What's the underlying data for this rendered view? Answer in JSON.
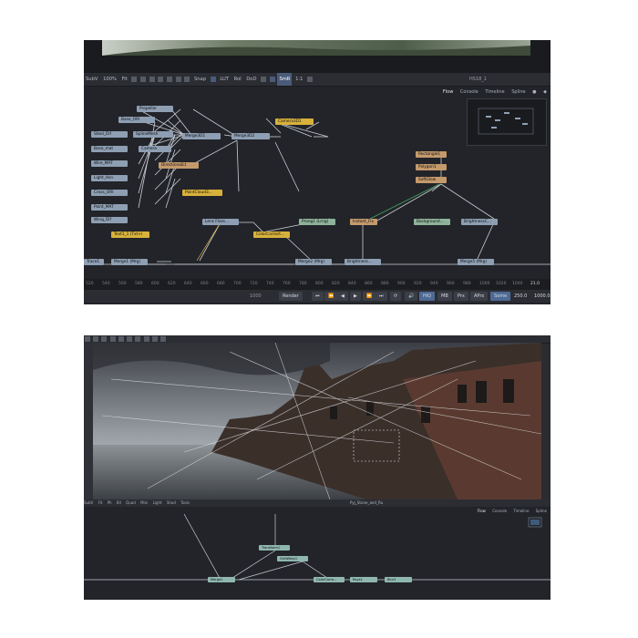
{
  "top": {
    "window_title": "HS18_1",
    "toolbar": {
      "items": [
        "SubV",
        "100%",
        "Fit",
        "Snap",
        "LUT",
        "RoI",
        "DoD",
        "SmR",
        "1:1"
      ]
    },
    "tabs": [
      "Flow",
      "Console",
      "Timeline",
      "Spline"
    ],
    "nodes": [
      {
        "id": "n1",
        "label": "Propeller",
        "color": "blue"
      },
      {
        "id": "n2",
        "label": "Base_ORI",
        "color": "blue"
      },
      {
        "id": "n3",
        "label": "Steel_Dif",
        "color": "blue"
      },
      {
        "id": "n4",
        "label": "SplineMesh",
        "color": "blue"
      },
      {
        "id": "n5",
        "label": "Merge3D1",
        "color": "blue"
      },
      {
        "id": "n6",
        "label": "Merge3D2",
        "color": "blue"
      },
      {
        "id": "n7",
        "label": "Camera3D1",
        "color": "yellow"
      },
      {
        "id": "n8",
        "label": "Base_mat",
        "color": "blue"
      },
      {
        "id": "n9",
        "label": "Camera",
        "color": "blue"
      },
      {
        "id": "n10",
        "label": "Wire_MAT",
        "color": "blue"
      },
      {
        "id": "n11",
        "label": "DirectionalLt",
        "color": "orange"
      },
      {
        "id": "n12",
        "label": "Light_Hsn",
        "color": "blue"
      },
      {
        "id": "n13",
        "label": "Cross_ORI",
        "color": "blue"
      },
      {
        "id": "n14",
        "label": "Point_MAT",
        "color": "blue"
      },
      {
        "id": "n15",
        "label": "Wing_Dif",
        "color": "blue"
      },
      {
        "id": "n16",
        "label": "PointCloud3...",
        "color": "yellow"
      },
      {
        "id": "n17",
        "label": "Rectangle1",
        "color": "orange"
      },
      {
        "id": "n18",
        "label": "Polygon1",
        "color": "orange"
      },
      {
        "id": "n19",
        "label": "SoftGlow",
        "color": "orange"
      },
      {
        "id": "n20",
        "label": "Text1_1 (Txt+)",
        "color": "yellow"
      },
      {
        "id": "n21",
        "label": "Lens Flare...",
        "color": "blue"
      },
      {
        "id": "n22",
        "label": "Prong1 (Lrng)",
        "color": "green"
      },
      {
        "id": "n23",
        "label": "Instant_Fix",
        "color": "orange"
      },
      {
        "id": "n24",
        "label": "Background...",
        "color": "green"
      },
      {
        "id": "n25",
        "label": "BrightnessC...",
        "color": "blue"
      },
      {
        "id": "n26",
        "label": "ColorCorrect...",
        "color": "yellow"
      },
      {
        "id": "n27",
        "label": "Merge1 (Mrg)",
        "color": "blue"
      },
      {
        "id": "n28",
        "label": "Merge2 (Mrg)",
        "color": "blue"
      },
      {
        "id": "n29",
        "label": "Brightness...",
        "color": "blue"
      },
      {
        "id": "n30",
        "label": "Merge5 (Mrg)",
        "color": "blue"
      },
      {
        "id": "n31",
        "label": "Trace1",
        "color": "blue"
      }
    ],
    "ruler": [
      "520",
      "540",
      "560",
      "580",
      "600",
      "620",
      "640",
      "660",
      "680",
      "700",
      "720",
      "740",
      "760",
      "780",
      "800",
      "820",
      "840",
      "860",
      "880",
      "900",
      "920",
      "940",
      "960",
      "980",
      "1000",
      "1020",
      "1040"
    ],
    "ruler_end": "21.0",
    "ruler_start_value": "1000",
    "transport": {
      "render": "Render",
      "hiq": "HiQ",
      "mb": "MB",
      "prx": "Prx",
      "aprx": "APrx",
      "some": "Some",
      "current": "250.0",
      "end": "1000.0"
    }
  },
  "bottom": {
    "viewer_name": "Pyj_Stone_and_Ru",
    "tabs": [
      "Flow",
      "Console",
      "Timeline",
      "Spline"
    ],
    "toolbar": [
      "SubV",
      "Fit",
      "Ph",
      "Bil",
      "Quad",
      "Mini",
      "Light",
      "Shad",
      "Tools"
    ],
    "nodes": [
      {
        "id": "b1",
        "label": "Transform1",
        "color": "teal"
      },
      {
        "id": "b2",
        "label": "GridWarp1",
        "color": "teal"
      },
      {
        "id": "b3",
        "label": "Merge1",
        "color": "teal"
      },
      {
        "id": "b4",
        "label": "ColorCorre...",
        "color": "teal"
      },
      {
        "id": "b5",
        "label": "Rays1",
        "color": "teal"
      },
      {
        "id": "b6",
        "label": "Blur1",
        "color": "teal"
      }
    ]
  },
  "colors": {
    "panel": "#222429",
    "toolbar": "#2b2d33",
    "node_blue": "#8e9fb3",
    "node_yellow": "#d8b13c",
    "node_green": "#8fb39a",
    "node_orange": "#c49a6c",
    "link": "#c9cdd4",
    "link_green": "#47a35a"
  }
}
